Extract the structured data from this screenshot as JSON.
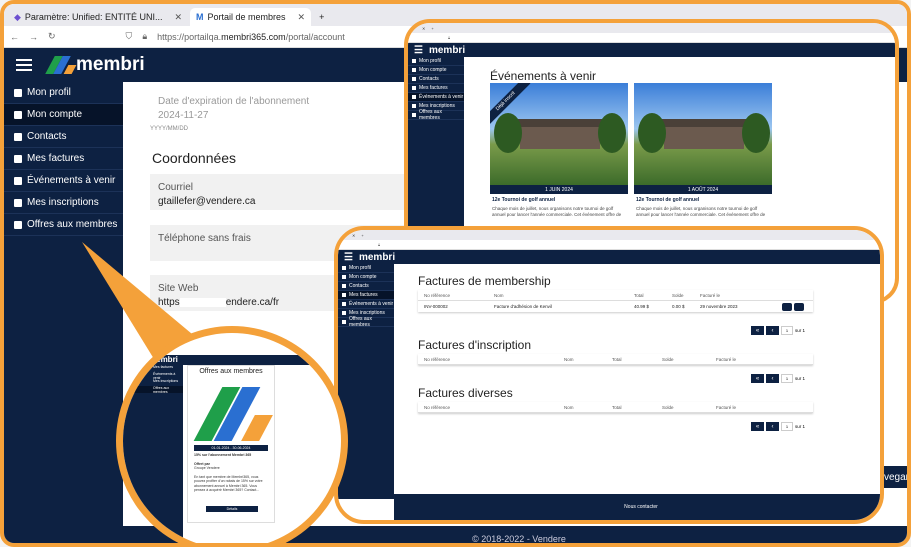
{
  "browser": {
    "tabs": [
      {
        "label": "Paramètre: Unified: ENTITÉ UNI...",
        "active": false
      },
      {
        "label": "Portail de membres",
        "active": true
      }
    ],
    "url_prefix": "https://portailqa.",
    "url_domain": "membri365.com",
    "url_path": "/portal/account"
  },
  "app": {
    "brand": "membri",
    "brand_colors": [
      "#1f9f4a",
      "#2a6fd1",
      "#f4a13a"
    ],
    "header_bg": "#0d2142"
  },
  "sidebar": {
    "items": [
      {
        "label": "Mon profil",
        "icon": "user-icon"
      },
      {
        "label": "Mon compte",
        "icon": "building-icon",
        "active": true
      },
      {
        "label": "Contacts",
        "icon": "users-icon"
      },
      {
        "label": "Mes factures",
        "icon": "invoice-icon"
      },
      {
        "label": "Événements à venir",
        "icon": "calendar-icon"
      },
      {
        "label": "Mes inscriptions",
        "icon": "list-icon"
      },
      {
        "label": "Offres aux membres",
        "icon": "gift-icon"
      }
    ]
  },
  "account": {
    "expiry_label": "Date d'expiration de l'abonnement",
    "expiry_value": "2024-11-27",
    "date_format": "YYYY/MM/DD",
    "section": "Coordonnées",
    "email_label": "Courriel",
    "email_value": "gtaillefer@vendere.ca",
    "phone_label": "Téléphone sans frais",
    "web_label": "Site Web",
    "web_value_a": "https",
    "web_value_b": "endere.ca/fr",
    "save": "Sauvegar",
    "footer": "© 2018-2022 - Vendere"
  },
  "events": {
    "title": "Événements à venir",
    "ribbon": "Déjà inscrit",
    "cards": [
      {
        "date": "1 JUIN 2024",
        "name": "12e Tournoi de golf annuel",
        "desc": "Chaque mois de juillet, nous organisons notre tournoi de golf annuel pour lancer l'année commerciale. Cet événement offre de"
      },
      {
        "date": "1 AOÛT 2024",
        "name": "12e Tournoi de golf annuel",
        "desc": "Chaque mois de juillet, nous organisons notre tournoi de golf annuel pour lancer l'année commerciale. Cet événement offre de"
      }
    ]
  },
  "invoices": {
    "membership_title": "Factures de membership",
    "inscription_title": "Factures d'inscription",
    "misc_title": "Factures diverses",
    "membership_headers": [
      "No référence",
      "Nom",
      "Total",
      "Solde",
      "Facturé le"
    ],
    "other_headers": [
      "No référence",
      "Nom",
      "Total",
      "Solde",
      "Facturé le"
    ],
    "membership_rows": [
      [
        "INV-000002",
        "Facture d'adhésion de Kenvil",
        "40.99 $",
        "0.00 $",
        "29 novembre 2023"
      ]
    ],
    "pager": {
      "page": "1",
      "of": "sur 1"
    },
    "footer": "Nous contacter",
    "footer_copy": "© 2018-2022 - Vendere"
  },
  "offer": {
    "title": "Offres aux membres",
    "date": "01-01-2024 - 30-06-2024",
    "name": "15% sur l'abonnement Membri 365",
    "sub": "Offert par",
    "company": "Groupe Vendere",
    "desc": "En tant que membre de Membri365, vous pouvez profiter d'un rabais de 15% sur votre abonnement annuel à Membri 365. Vous pensez à acquérir Membri 365? Contact...",
    "button": "Détails"
  }
}
